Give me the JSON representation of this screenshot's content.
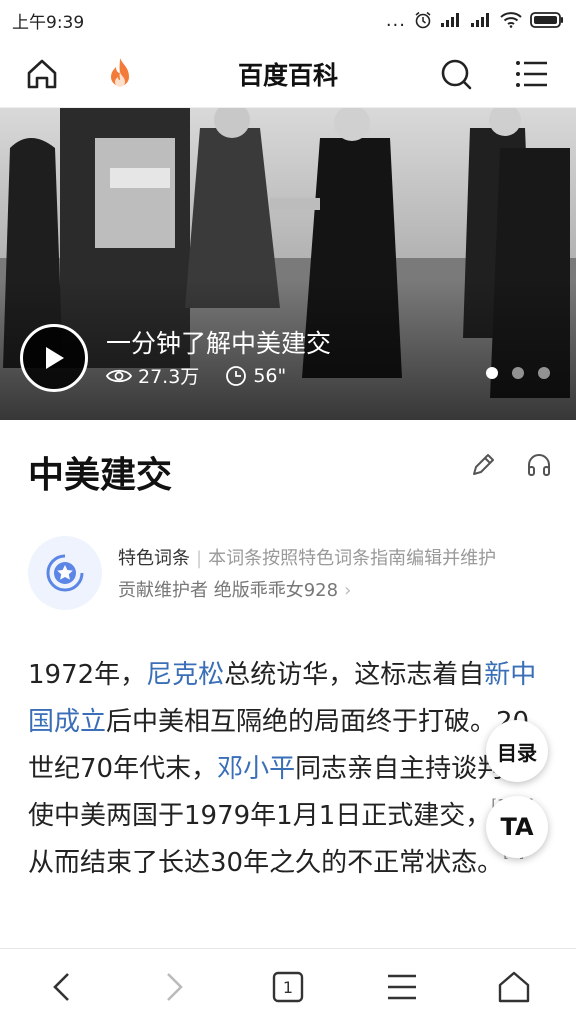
{
  "status": {
    "time": "上午9:39",
    "dots": "..."
  },
  "header": {
    "title": "百度百科"
  },
  "hero": {
    "title": "一分钟了解中美建交",
    "views": "27.3万",
    "duration": "56\""
  },
  "entry": {
    "title": "中美建交"
  },
  "feature": {
    "tag": "特色词条",
    "separator": "|",
    "description": "本词条按照特色词条指南编辑并维护",
    "contributor_prefix": "贡献维护者",
    "contributor_name": "绝版乖乖女928",
    "arrow": "›"
  },
  "article": {
    "p1": "1972年，",
    "link1": "尼克松",
    "p2": "总统访华，这标志着自",
    "link2": "新中国成立",
    "p3": "后中美相互隔绝的局面终于打破。20世纪70年代末，",
    "link3": "邓小平",
    "p4": "同志亲自主持谈判，使中美两国于1979年1月1日正式建交，",
    "ref1": "[1][2]",
    "p5": "从而结束了长达30年之久的不正常状态。",
    "ref2": "[3]"
  },
  "floating": {
    "toc_label": "目录",
    "ta_label": "TA"
  },
  "bottom_nav": {
    "tab_count": "1"
  },
  "colors": {
    "link": "#3a6fb8",
    "brand_orange": "#f37b3a"
  }
}
